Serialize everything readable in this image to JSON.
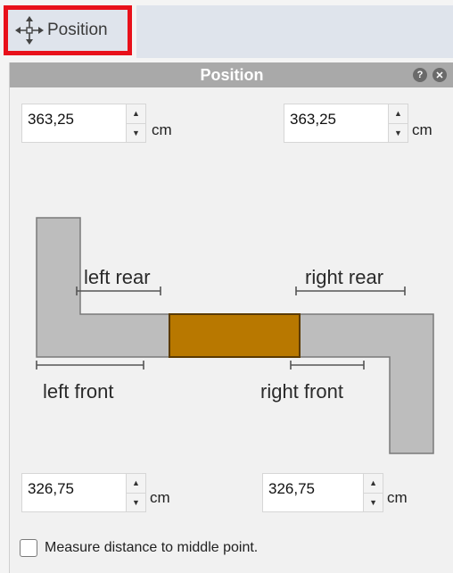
{
  "toolbar": {
    "tab_label": "Position",
    "tab_icon": "move-arrows-icon"
  },
  "panel": {
    "title": "Position",
    "help_icon": "help-icon",
    "close_icon": "close-icon"
  },
  "fields": {
    "left_rear_value": "363,25",
    "right_rear_value": "363,25",
    "left_front_value": "326,75",
    "right_front_value": "326,75",
    "unit": "cm"
  },
  "diagram": {
    "left_rear": "left rear",
    "right_rear": "right rear",
    "left_front": "left front",
    "right_front": "right front",
    "colors": {
      "wall": "#bdbdbd",
      "wall_outline": "#7a7a7a",
      "item": "#b87800",
      "item_outline": "#5a3a00"
    }
  },
  "checkbox": {
    "label": "Measure distance to middle point.",
    "checked": false
  }
}
